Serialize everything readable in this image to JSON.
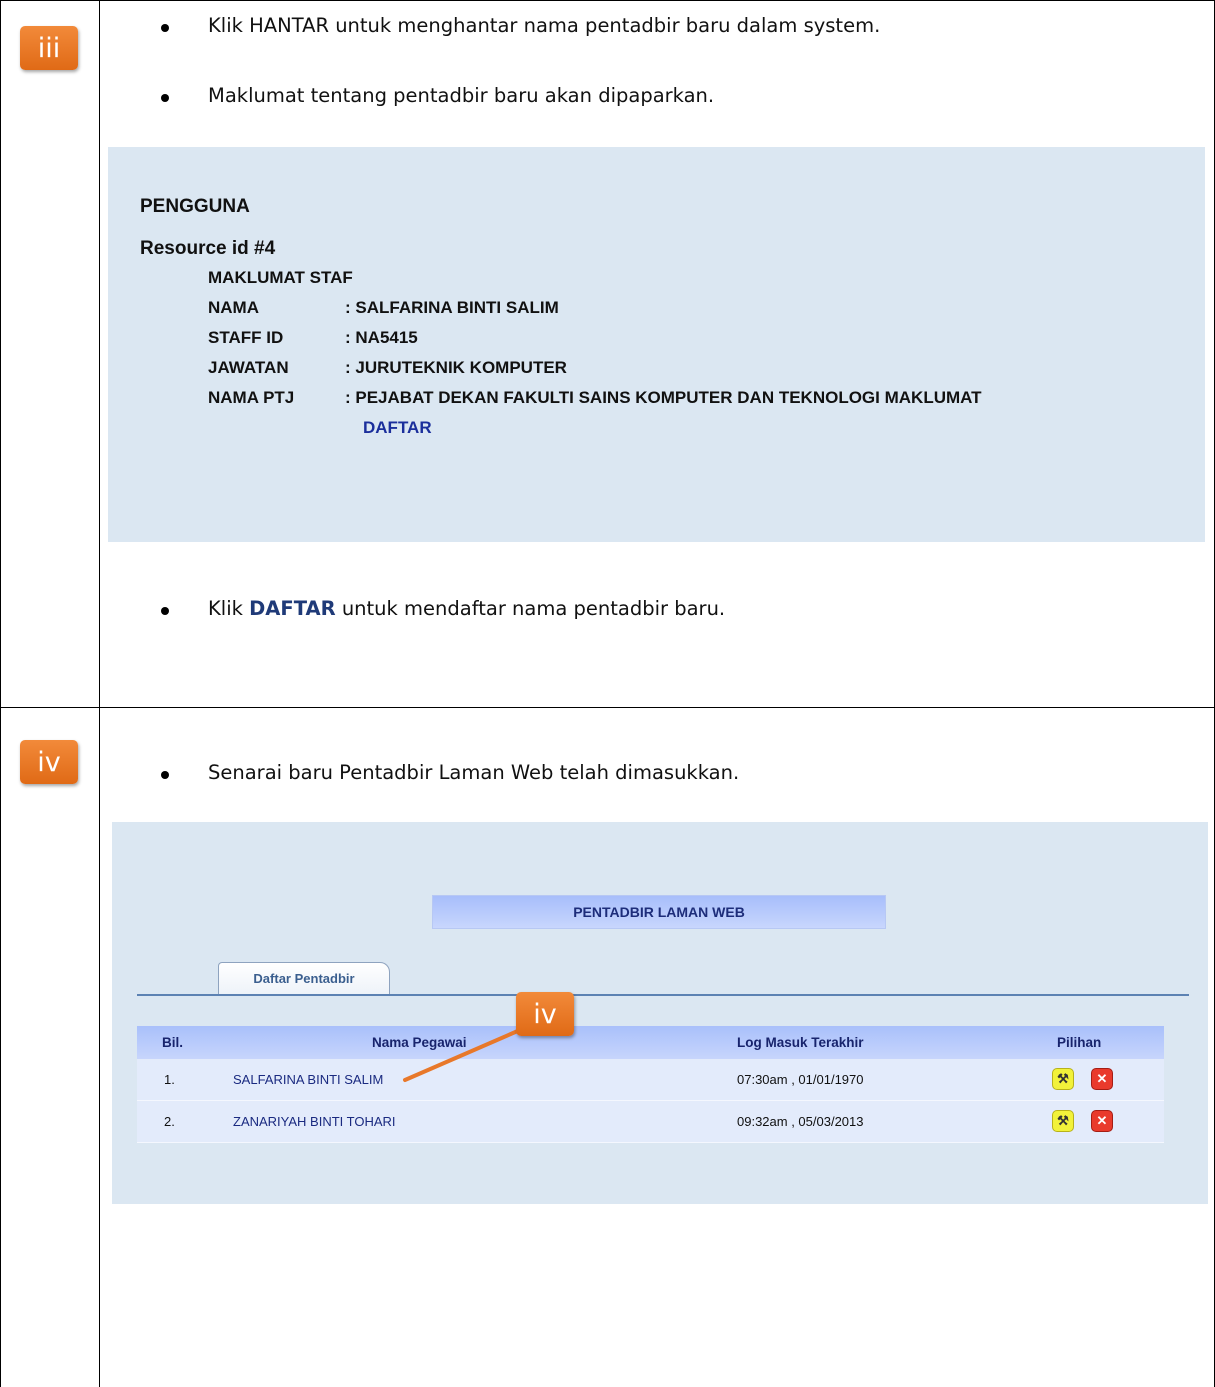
{
  "steps": {
    "step3_badge": "iii",
    "step4_badge": "iv"
  },
  "step3": {
    "bullet1": "Klik HANTAR untuk menghantar nama pentadbir baru dalam system.",
    "bullet2": "Maklumat tentang pentadbir baru akan dipaparkan.",
    "bullet3_prefix": "Klik ",
    "bullet3_bold": "DAFTAR",
    "bullet3_suffix": " untuk mendaftar nama pentadbir baru."
  },
  "screen1": {
    "heading": "PENGGUNA",
    "resource": "Resource id #4",
    "section_title": "MAKLUMAT STAF",
    "fields": [
      {
        "label": "NAMA",
        "value": ": SALFARINA BINTI SALIM"
      },
      {
        "label": "STAFF ID",
        "value": ": NA5415"
      },
      {
        "label": "JAWATAN",
        "value": ": JURUTEKNIK KOMPUTER"
      },
      {
        "label": "NAMA PTJ",
        "value": ": PEJABAT DEKAN FAKULTI SAINS KOMPUTER DAN TEKNOLOGI MAKLUMAT"
      }
    ],
    "daftar_link": "DAFTAR"
  },
  "step4": {
    "bullet1": "Senarai baru Pentadbir Laman Web telah dimasukkan."
  },
  "screen2": {
    "title": "PENTADBIR LAMAN WEB",
    "tab": "Daftar Pentadbir",
    "callout": "iv",
    "columns": [
      "Bil.",
      "Nama Pegawai",
      "Log Masuk Terakhir",
      "Pilihan"
    ],
    "rows": [
      {
        "bil": "1.",
        "nama": "SALFARINA BINTI SALIM",
        "log": "07:30am , 01/01/1970"
      },
      {
        "bil": "2.",
        "nama": "ZANARIYAH BINTI TOHARI",
        "log": "09:32am , 05/03/2013"
      }
    ],
    "edit_icon": "wrench-icon",
    "delete_icon": "close-icon",
    "colors": {
      "badge": "#e8782a",
      "panel_bg": "#dbe7f2",
      "header_bg": "#b5c8fb",
      "row_bg": "#e3ebfb"
    }
  }
}
